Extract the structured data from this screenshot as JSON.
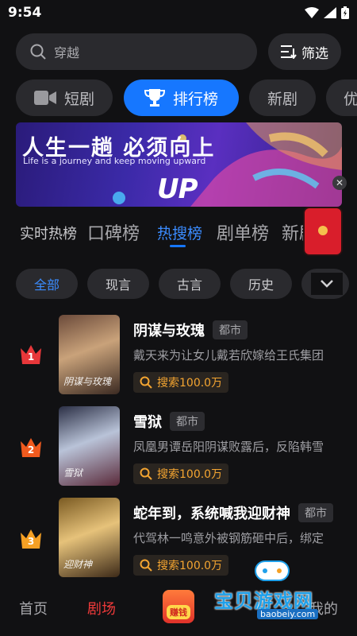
{
  "status_bar": {
    "time": "9:54"
  },
  "search": {
    "placeholder": "穿越",
    "filter_label": "筛选"
  },
  "categories": [
    {
      "label": "短剧",
      "icon": "video-camera-icon"
    },
    {
      "label": "排行榜",
      "icon": "trophy-icon",
      "active": true
    },
    {
      "label": "新剧"
    },
    {
      "label": "优"
    }
  ],
  "banner": {
    "headline": "人生一趟  必须向上",
    "subline": "Life is a journey and   keep moving upward",
    "logo_text": "UP"
  },
  "ranking_tabs": [
    {
      "label": "实时热榜"
    },
    {
      "label": "口碑榜"
    },
    {
      "label": "热搜榜",
      "active": true
    },
    {
      "label": "剧单榜"
    },
    {
      "label": "新剧榜"
    }
  ],
  "genres": [
    {
      "label": "全部",
      "active": true
    },
    {
      "label": "现言"
    },
    {
      "label": "古言"
    },
    {
      "label": "历史"
    }
  ],
  "rank_items": [
    {
      "rank": "1",
      "crown_color": "#e8373a",
      "title": "阴谋与玫瑰",
      "tag": "都市",
      "desc": "戴天来为让女儿戴若欣嫁给王氏集团",
      "hot": "搜索100.0万",
      "poster_text": "阴谋与玫瑰"
    },
    {
      "rank": "2",
      "crown_color": "#f05a1e",
      "title": "雪狱",
      "tag": "都市",
      "desc": "凤凰男谭岳阳阴谋败露后，反陷韩雪",
      "hot": "搜索100.0万",
      "poster_text": "雪狱"
    },
    {
      "rank": "3",
      "crown_color": "#f5a024",
      "title": "蛇年到，系统喊我迎财神",
      "tag": "都市",
      "desc": "代驾林一鸣意外被钢筋砸中后，绑定",
      "hot": "搜索100.0万",
      "poster_text": "迎财神"
    }
  ],
  "bottom_nav": [
    {
      "label": "首页"
    },
    {
      "label": "剧场",
      "active": true
    },
    {
      "label": "赚钱"
    },
    {
      "label": "我的"
    }
  ],
  "watermark": {
    "name": "宝贝游戏网",
    "url": "baobeiy.com"
  }
}
